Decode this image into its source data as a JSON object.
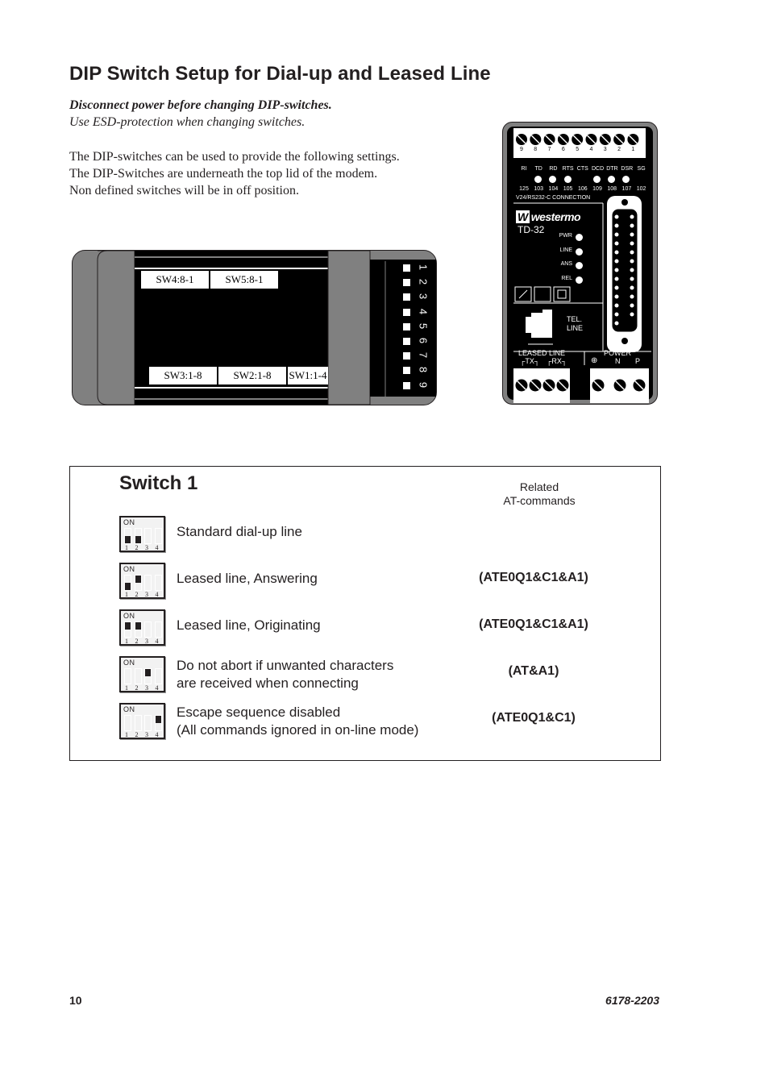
{
  "page": {
    "title": "DIP Switch Setup for Dial-up and Leased Line",
    "warning_bold": "Disconnect power before changing DIP-switches.",
    "warning_italic": "Use ESD-protection when changing switches.",
    "body_lines": [
      "The DIP-switches can be used to provide the following settings.",
      "The DIP-Switches are underneath the top lid of the modem.",
      "Non defined switches will be in off position."
    ]
  },
  "modem_top_view": {
    "switch_labels": [
      "SW4:8-1",
      "SW5:8-1",
      "SW3:1-8",
      "SW2:1-8",
      "SW1:1-4"
    ],
    "led_numbers": [
      "1",
      "2",
      "3",
      "4",
      "5",
      "6",
      "7",
      "8",
      "9"
    ]
  },
  "modem_front_view": {
    "terminal_numbers": [
      "9",
      "8",
      "7",
      "6",
      "5",
      "4",
      "3",
      "2",
      "1"
    ],
    "signal_names": [
      "RI",
      "TD",
      "RD",
      "RTS",
      "CTS",
      "DCD",
      "DTR",
      "DSR",
      "SG"
    ],
    "signal_lit": [
      false,
      true,
      true,
      true,
      false,
      true,
      true,
      true,
      false
    ],
    "signal_numbers": [
      "125",
      "103",
      "104",
      "105",
      "106",
      "109",
      "108",
      "107",
      "102"
    ],
    "connection_label": "V24/RS232-C CONNECTION",
    "brand": "westermo",
    "model": "TD-32",
    "status_leds": [
      "PWR",
      "LINE",
      "ANS",
      "REL"
    ],
    "tel_line_label": [
      "TEL.",
      "LINE"
    ],
    "leased_line_label": "LEASED LINE",
    "tx_label": "TX",
    "rx_label": "RX",
    "power_label": "POWER",
    "power_terminals": [
      "⊕",
      "N",
      "P"
    ]
  },
  "switch1": {
    "title": "Switch 1",
    "at_header": [
      "Related",
      "AT-commands"
    ],
    "dip_on_label": "ON",
    "dip_numbers": [
      "1",
      "2",
      "3",
      "4"
    ],
    "rows": [
      {
        "description": [
          "Standard dial-up line"
        ],
        "switch_on": [
          false,
          false,
          false,
          false
        ],
        "at_command": ""
      },
      {
        "description": [
          "Leased line, Answering"
        ],
        "switch_on": [
          false,
          true,
          false,
          false
        ],
        "at_command": "(ATE0Q1&C1&A1)"
      },
      {
        "description": [
          "Leased line, Originating"
        ],
        "switch_on": [
          true,
          true,
          false,
          false
        ],
        "at_command": "(ATE0Q1&C1&A1)"
      },
      {
        "description": [
          "Do not abort if unwanted characters",
          "are received when connecting"
        ],
        "switch_on": [
          false,
          false,
          true,
          false
        ],
        "at_command": "(AT&A1)"
      },
      {
        "description": [
          "Escape sequence disabled",
          "(All commands ignored in on-line mode)"
        ],
        "switch_on": [
          false,
          false,
          false,
          true
        ],
        "at_command": "(ATE0Q1&C1)"
      }
    ]
  },
  "footer": {
    "page_number": "10",
    "document_number": "6178-2203"
  }
}
